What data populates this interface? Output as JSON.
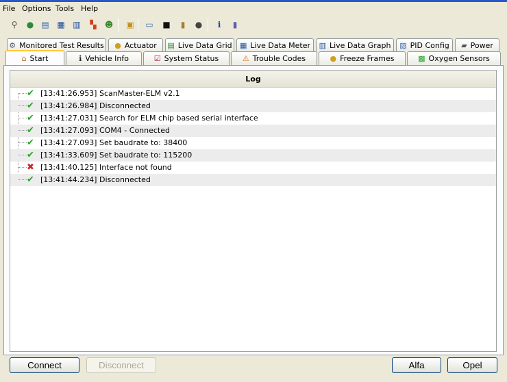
{
  "menu": [
    "File",
    "Options",
    "Tools",
    "Help"
  ],
  "toolbar": [
    "plug-icon",
    "globe-icon",
    "document-icon",
    "grid-icon",
    "chart-icon",
    "puzzle-icon",
    "person-icon",
    "clipboard-icon",
    "monitor-icon",
    "terminal-icon",
    "battery-icon",
    "gauge-icon",
    "info-icon",
    "door-icon"
  ],
  "tabs_row1": [
    {
      "label": "Monitored Test Results",
      "icon": "⚙"
    },
    {
      "label": "Actuator",
      "icon": "●"
    },
    {
      "label": "Live Data Grid",
      "icon": "▤"
    },
    {
      "label": "Live Data Meter",
      "icon": "▦"
    },
    {
      "label": "Live Data Graph",
      "icon": "▥"
    },
    {
      "label": "PID Config",
      "icon": "▧"
    },
    {
      "label": "Power",
      "icon": "▰"
    }
  ],
  "tabs_row2": [
    {
      "label": "Start",
      "icon": "⌂",
      "selected": true
    },
    {
      "label": "Vehicle Info",
      "icon": "ℹ"
    },
    {
      "label": "System Status",
      "icon": "☑"
    },
    {
      "label": "Trouble Codes",
      "icon": "⚠"
    },
    {
      "label": "Freeze Frames",
      "icon": "●"
    },
    {
      "label": "Oxygen Sensors",
      "icon": "▩"
    }
  ],
  "log": {
    "header": "Log",
    "entries": [
      {
        "status": "ok",
        "text": "[13:41:26.953] ScanMaster-ELM v2.1"
      },
      {
        "status": "ok",
        "text": "[13:41:26.984] Disconnected"
      },
      {
        "status": "ok",
        "text": "[13:41:27.031] Search for ELM chip based serial interface"
      },
      {
        "status": "ok",
        "text": "[13:41:27.093] COM4 - Connected"
      },
      {
        "status": "ok",
        "text": "[13:41:27.093] Set baudrate to: 38400"
      },
      {
        "status": "ok",
        "text": "[13:41:33.609] Set baudrate to: 115200"
      },
      {
        "status": "error",
        "text": "[13:41:40.125] Interface not found"
      },
      {
        "status": "ok",
        "text": "[13:41:44.234] Disconnected"
      }
    ]
  },
  "buttons": {
    "connect": "Connect",
    "disconnect": "Disconnect",
    "alfa": "Alfa",
    "opel": "Opel"
  }
}
